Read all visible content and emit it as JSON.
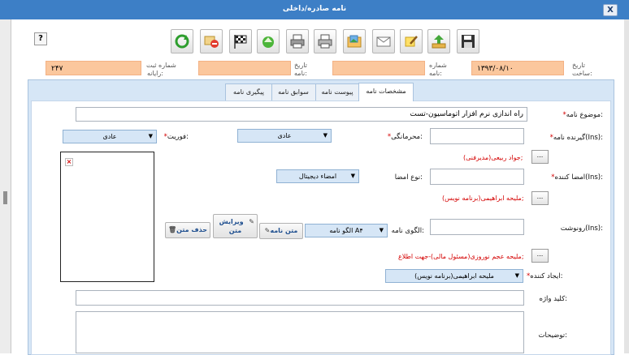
{
  "window": {
    "title": "نامه صادره/داخلی",
    "close": "X"
  },
  "help": "?",
  "header": {
    "reg_label_1": "شماره ثبت",
    "reg_label_2": "رایانه:",
    "reg_value": "۲۴۷",
    "date_label_1": "تاریخ",
    "date_label_2": "نامه:",
    "date_value": "",
    "number_label_1": "شماره",
    "number_label_2": "نامه:",
    "number_value": "",
    "created_label_1": "تاریخ",
    "created_label_2": "ساخت:",
    "created_value": "۱۳۹۳/۰۸/۱۰"
  },
  "tabs": [
    "مشخصات نامه",
    "پیوست نامه",
    "سوابق نامه",
    "پیگیری نامه"
  ],
  "form": {
    "subject_label": "موضوع نامه:",
    "subject_value": "راه اندازی نرم افزار اتوماسیون-تست",
    "recipient_label": "گیرنده نامه(Ins):",
    "confidential_label": "محرمانگی:",
    "confidential_value": "عادی",
    "urgency_label": "فوریت:",
    "urgency_value": "عادی",
    "recipient_name": "جواد ربیعی(مدیرفنی);",
    "signer_label": "امضا کننده(Ins):",
    "signtype_label": "نوع امضا:",
    "signtype_value": "امضاء دیجیتال",
    "signer_name": "ملیحه ابراهیمی(برنامه نویس);",
    "cc_label": "رونوشت(Ins):",
    "template_label": "الگوی نامه:",
    "template_value": "الگو نامه A۴",
    "btn_letter_text": "متن نامه",
    "btn_edit_text": "ویرایش متن",
    "btn_delete_text": "حذف متن",
    "cc_name": "ملیحه عجم نوروزی(مسئول مالی)-جهت اطلاع;",
    "creator_label": "ایجاد کننده:",
    "creator_value": "ملیحه ابراهیمی(برنامه نویس)",
    "keyword_label": "کلید واژه:",
    "notes_label": "توضیحات:",
    "browse": "..."
  },
  "colors": {
    "titlebar": "#3d7fc6",
    "orange": "#fbc79d",
    "panel": "#d6e6f6",
    "required": "#d40000"
  }
}
